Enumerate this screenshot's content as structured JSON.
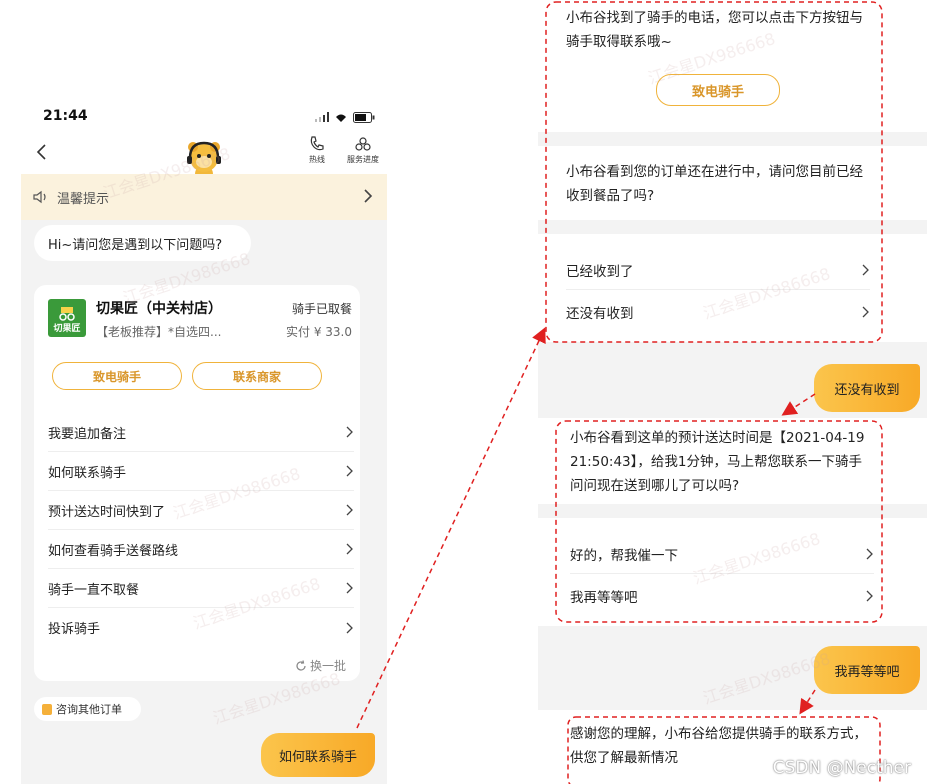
{
  "left_screen": {
    "status_time": "21:44",
    "nav": {
      "hotline_label": "热线",
      "progress_label": "服务进度"
    },
    "tip_text": "温馨提示",
    "greeting": "Hi~请问您是遇到以下问题吗?",
    "order": {
      "shop_logo_text": "切果匠",
      "shop_name": "切果匠（中关村店）",
      "item": "【老板推荐】*自选四...",
      "status": "骑手已取餐",
      "paid": "实付 ¥ 33.0",
      "call_rider": "致电骑手",
      "contact_merchant": "联系商家"
    },
    "faq": [
      "我要追加备注",
      "如何联系骑手",
      "预计送达时间快到了",
      "如何查看骑手送餐路线",
      "骑手一直不取餐",
      "投诉骑手"
    ],
    "refresh_label": "换一批",
    "other_orders": "咨询其他订单",
    "user_message": "如何联系骑手"
  },
  "right_screen": {
    "msg1": "小布谷找到了骑手的电话，您可以点击下方按钮与骑手取得联系哦~",
    "call_rider_button": "致电骑手",
    "msg2": "小布谷看到您的订单还在进行中，请问您目前已经收到餐品了吗?",
    "options1": [
      "已经收到了",
      "还没有收到"
    ],
    "user_reply1": "还没有收到",
    "msg3": "小布谷看到这单的预计送达时间是【2021-04-19 21:50:43】，给我1分钟，马上帮您联系一下骑手问问现在送到哪儿了可以吗?",
    "options2": [
      "好的，帮我催一下",
      "我再等等吧"
    ],
    "user_reply2": "我再等等吧",
    "msg4": "感谢您的理解，小布谷给您提供骑手的联系方式，供您了解最新情况"
  },
  "watermark_text": "江会星DX986668",
  "credit": "CSDN @Necther",
  "colors": {
    "accent": "#f8a927",
    "annotation": "#e02020",
    "tip_bg": "#fbf2dd"
  }
}
